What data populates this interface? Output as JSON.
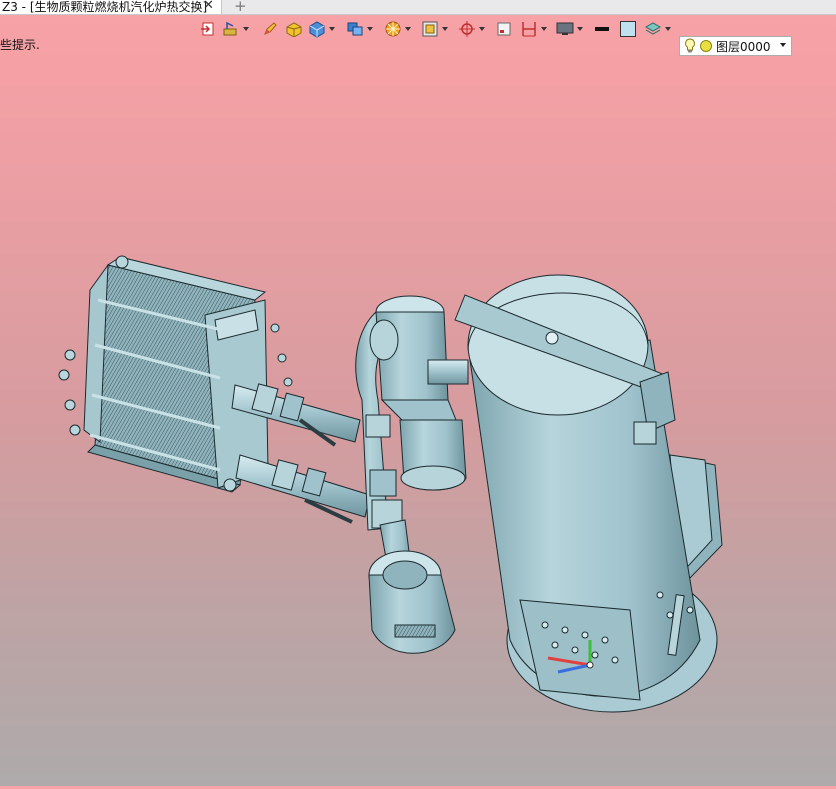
{
  "tab": {
    "title": "Z3 - [生物质颗粒燃烧机汽化炉热交换]",
    "close_glyph": "✕",
    "add_glyph": "+"
  },
  "hint": "些提示.",
  "toolbar": {
    "items": [
      {
        "name": "exit-sketch-icon"
      },
      {
        "name": "sketch-tools-icon"
      },
      {
        "name": "pencil-icon"
      },
      {
        "name": "solid-color-icon"
      },
      {
        "name": "cube-view-icon"
      },
      {
        "name": "display-mode-icon"
      },
      {
        "name": "render-options-icon"
      },
      {
        "name": "layer-filter-icon"
      },
      {
        "name": "snap-point-icon"
      },
      {
        "name": "frame-icon"
      },
      {
        "name": "dimension-icon"
      },
      {
        "name": "monitor-icon"
      },
      {
        "name": "line-color-swatch-icon"
      },
      {
        "name": "fill-color-swatch-icon"
      },
      {
        "name": "layer-stack-icon"
      }
    ],
    "layer": {
      "bulb_icon": "lightbulb-icon",
      "dot_icon": "layer-status-dot-icon",
      "label": "图层0000"
    }
  },
  "colors": {
    "background_top": "#f7a2a6",
    "background_bottom": "#aeaaab",
    "model_body": "#9fc2cc",
    "model_shadow": "#6d949e",
    "model_highlight": "#d6ecf0",
    "triad_x": "#e04040",
    "triad_y": "#3cbf3c",
    "triad_z": "#3a6ee0"
  }
}
